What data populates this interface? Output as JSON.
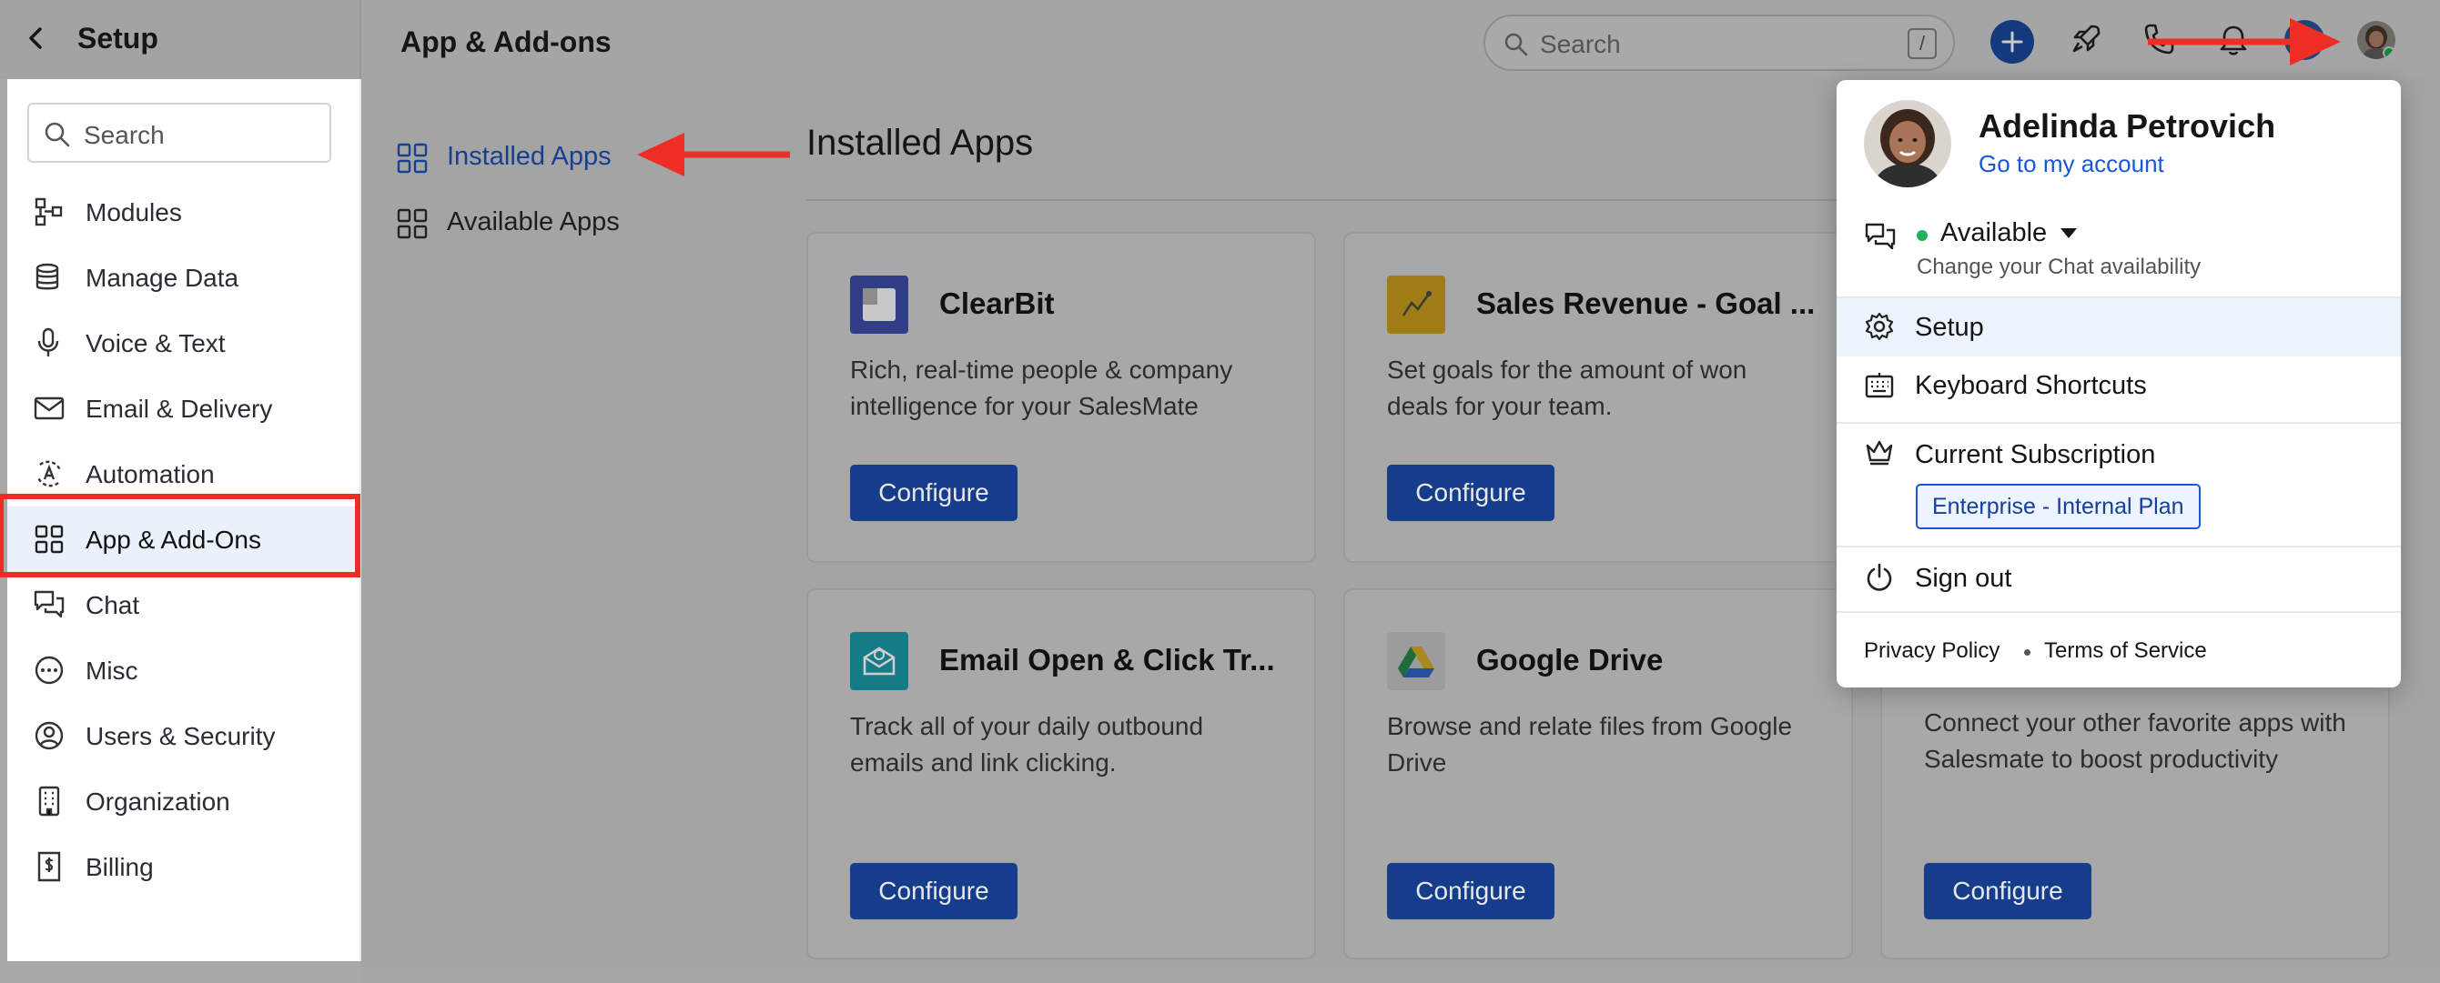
{
  "topbar": {
    "setup_title": "Setup",
    "page_title": "App & Add-ons",
    "search_placeholder": "Search",
    "search_shortcut": "/"
  },
  "sidebar": {
    "search_placeholder": "Search",
    "items": [
      {
        "label": "Modules",
        "icon": "modules-icon"
      },
      {
        "label": "Manage Data",
        "icon": "database-icon"
      },
      {
        "label": "Voice & Text",
        "icon": "microphone-icon"
      },
      {
        "label": "Email & Delivery",
        "icon": "envelope-icon"
      },
      {
        "label": "Automation",
        "icon": "automation-icon"
      },
      {
        "label": "App & Add-Ons",
        "icon": "grid-icon",
        "active": true
      },
      {
        "label": "Chat",
        "icon": "chat-icon"
      },
      {
        "label": "Misc",
        "icon": "more-circle-icon"
      },
      {
        "label": "Users & Security",
        "icon": "user-circle-icon"
      },
      {
        "label": "Organization",
        "icon": "building-icon"
      },
      {
        "label": "Billing",
        "icon": "billing-icon"
      }
    ]
  },
  "subnav": {
    "installed": "Installed Apps",
    "available": "Available Apps"
  },
  "section_title": "Installed Apps",
  "cards": [
    {
      "name": "ClearBit",
      "desc": "Rich, real-time people & company intelligence for your SalesMate",
      "button": "Configure",
      "logo_color": "#2f3e86"
    },
    {
      "name": "Sales Revenue - Goal ...",
      "desc": "Set goals for the amount of won deals for your team.",
      "button": "Configure",
      "logo_color": "#a07c16"
    },
    {
      "name": "Email Open & Click Tr...",
      "desc": "Track all of your daily outbound emails and link clicking.",
      "button": "Configure",
      "logo_color": "#167b86"
    },
    {
      "name": "Google Drive",
      "desc": "Browse and relate files from Google Drive",
      "button": "Configure",
      "logo_color": "#9a9a9a"
    },
    {
      "name": "",
      "desc": "Connect your other favorite apps with Salesmate to boost productivity",
      "button": "Configure"
    }
  ],
  "menu": {
    "user_name": "Adelinda Petrovich",
    "account_link": "Go to my account",
    "availability": "Available",
    "availability_sub": "Change your Chat availability",
    "setup": "Setup",
    "shortcuts": "Keyboard Shortcuts",
    "subscription": "Current Subscription",
    "plan": "Enterprise - Internal Plan",
    "sign_out": "Sign out",
    "privacy": "Privacy Policy",
    "terms": "Terms of Service"
  },
  "colors": {
    "accent": "#1a56db",
    "highlight": "#ee2e24",
    "available": "#20b35a"
  }
}
